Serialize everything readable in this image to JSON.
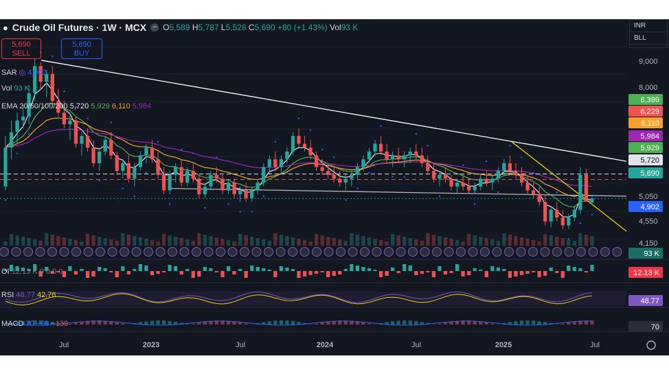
{
  "header": {
    "title": "Crude Oil Futures · 1W · MCX",
    "ohlc_o_label": "O",
    "ohlc_o": "5,589",
    "ohlc_h_label": "H",
    "ohlc_h": "5,787",
    "ohlc_l_label": "L",
    "ohlc_l": "5,528",
    "ohlc_c_label": "C",
    "ohlc_c": "5,690",
    "change": "+80 (+1.43%)",
    "vol_label": "Vol",
    "vol": "93 K"
  },
  "trade": {
    "sell_price": "5,690",
    "sell_label": "SELL",
    "buy_price": "5,690",
    "buy_label": "BUY"
  },
  "indicators": {
    "sar": {
      "label": "SAR",
      "value": "4,902"
    },
    "vol": {
      "label": "Vol",
      "value": "93 K"
    },
    "ema": {
      "label": "EMA 20/50/100/200",
      "v20": "5,720",
      "v50": "5,929",
      "v100": "6,110",
      "v200": "5,984"
    },
    "oi": {
      "label": "OI",
      "value": "12.13 K",
      "extra": "0 0 0 0"
    },
    "rsi": {
      "label": "RSI",
      "value": "48.77",
      "ma": "42.76"
    },
    "macd": {
      "label": "MACD",
      "value": "70",
      "signal": "−69",
      "hist": "−139"
    }
  },
  "currency": {
    "cur": "INR",
    "unit": "BLL"
  },
  "colors": {
    "bg": "#131722",
    "up": "#26a69a",
    "down": "#ef5350",
    "ema20": "#e0e3eb",
    "ema50": "#4caf50",
    "ema100": "#f7a12b",
    "ema200": "#9c27b0",
    "sar": "#2962ff",
    "trend_white": "#ffffff",
    "trend_yellow": "#f0d000"
  },
  "chart_data": {
    "type": "candlestick",
    "symbol": "Crude Oil Futures",
    "interval": "1W",
    "exchange": "MCX",
    "x_tick_labels": [
      "Jul",
      "2023",
      "Jul",
      "2024",
      "Jul",
      "2025",
      "Jul"
    ],
    "y_tick_labels": [
      9000,
      8000,
      5050,
      4550,
      4150
    ],
    "price_axis_labels": [
      {
        "value": "6,399",
        "color": "#4caf50"
      },
      {
        "value": "6,229",
        "color": "#ef5350"
      },
      {
        "value": "6,110",
        "color": "#f7a12b"
      },
      {
        "value": "5,984",
        "color": "#9c27b0"
      },
      {
        "value": "5,929",
        "color": "#4caf50"
      },
      {
        "value": "5,720",
        "color": "#e0e3eb"
      },
      {
        "value": "5,690",
        "color": "#26a69a"
      },
      {
        "value": "4,902",
        "color": "#2962ff"
      }
    ],
    "volume_label": "93 K",
    "oi_label": "12.13 K",
    "rsi_labels": [
      "48.77"
    ],
    "macd_label": "70",
    "candles": [
      {
        "o": 6000,
        "h": 7300,
        "l": 5900,
        "c": 7000
      },
      {
        "o": 7000,
        "h": 7700,
        "l": 6700,
        "c": 7400
      },
      {
        "o": 7400,
        "h": 7900,
        "l": 7100,
        "c": 7700
      },
      {
        "o": 7700,
        "h": 8100,
        "l": 7500,
        "c": 7800
      },
      {
        "o": 7800,
        "h": 8600,
        "l": 7600,
        "c": 8400
      },
      {
        "o": 8400,
        "h": 9300,
        "l": 8200,
        "c": 9100
      },
      {
        "o": 9100,
        "h": 9200,
        "l": 8500,
        "c": 8700
      },
      {
        "o": 8700,
        "h": 9000,
        "l": 8300,
        "c": 8900
      },
      {
        "o": 8900,
        "h": 9100,
        "l": 8100,
        "c": 8200
      },
      {
        "o": 8200,
        "h": 8500,
        "l": 7800,
        "c": 7900
      },
      {
        "o": 7900,
        "h": 8200,
        "l": 7500,
        "c": 7600
      },
      {
        "o": 7600,
        "h": 7900,
        "l": 7200,
        "c": 7700
      },
      {
        "o": 7700,
        "h": 7800,
        "l": 7000,
        "c": 7100
      },
      {
        "o": 7100,
        "h": 7400,
        "l": 6800,
        "c": 7300
      },
      {
        "o": 7300,
        "h": 7500,
        "l": 6900,
        "c": 7000
      },
      {
        "o": 7000,
        "h": 7200,
        "l": 6500,
        "c": 6600
      },
      {
        "o": 6600,
        "h": 7000,
        "l": 6400,
        "c": 6900
      },
      {
        "o": 6900,
        "h": 7300,
        "l": 6800,
        "c": 7200
      },
      {
        "o": 7200,
        "h": 7400,
        "l": 6700,
        "c": 6800
      },
      {
        "o": 6800,
        "h": 6900,
        "l": 6300,
        "c": 6400
      },
      {
        "o": 6400,
        "h": 6700,
        "l": 6200,
        "c": 6600
      },
      {
        "o": 6600,
        "h": 6800,
        "l": 6100,
        "c": 6200
      },
      {
        "o": 6200,
        "h": 6600,
        "l": 6000,
        "c": 6500
      },
      {
        "o": 6500,
        "h": 6900,
        "l": 6400,
        "c": 6800
      },
      {
        "o": 6800,
        "h": 7100,
        "l": 6600,
        "c": 7000
      },
      {
        "o": 7000,
        "h": 7200,
        "l": 6600,
        "c": 6700
      },
      {
        "o": 6700,
        "h": 6900,
        "l": 6200,
        "c": 6300
      },
      {
        "o": 6300,
        "h": 6500,
        "l": 5800,
        "c": 5900
      },
      {
        "o": 5900,
        "h": 6400,
        "l": 5800,
        "c": 6300
      },
      {
        "o": 6300,
        "h": 6600,
        "l": 6100,
        "c": 6500
      },
      {
        "o": 6500,
        "h": 6700,
        "l": 6000,
        "c": 6100
      },
      {
        "o": 6100,
        "h": 6500,
        "l": 6000,
        "c": 6400
      },
      {
        "o": 6400,
        "h": 6600,
        "l": 6100,
        "c": 6200
      },
      {
        "o": 6200,
        "h": 6300,
        "l": 5700,
        "c": 5800
      },
      {
        "o": 5800,
        "h": 6100,
        "l": 5700,
        "c": 6000
      },
      {
        "o": 6000,
        "h": 6400,
        "l": 5900,
        "c": 6300
      },
      {
        "o": 6300,
        "h": 6500,
        "l": 6100,
        "c": 6200
      },
      {
        "o": 6200,
        "h": 6300,
        "l": 5800,
        "c": 5900
      },
      {
        "o": 5900,
        "h": 6200,
        "l": 5800,
        "c": 6100
      },
      {
        "o": 6100,
        "h": 6200,
        "l": 5700,
        "c": 5800
      },
      {
        "o": 5800,
        "h": 6000,
        "l": 5600,
        "c": 5900
      },
      {
        "o": 5900,
        "h": 6100,
        "l": 5600,
        "c": 5700
      },
      {
        "o": 5700,
        "h": 6000,
        "l": 5600,
        "c": 5900
      },
      {
        "o": 5900,
        "h": 6200,
        "l": 5800,
        "c": 6100
      },
      {
        "o": 6100,
        "h": 6600,
        "l": 6000,
        "c": 6500
      },
      {
        "o": 6500,
        "h": 6800,
        "l": 6300,
        "c": 6700
      },
      {
        "o": 6700,
        "h": 6900,
        "l": 6400,
        "c": 6500
      },
      {
        "o": 6500,
        "h": 6800,
        "l": 6300,
        "c": 6700
      },
      {
        "o": 6700,
        "h": 7000,
        "l": 6600,
        "c": 6900
      },
      {
        "o": 6900,
        "h": 7400,
        "l": 6800,
        "c": 7300
      },
      {
        "o": 7300,
        "h": 7500,
        "l": 7000,
        "c": 7100
      },
      {
        "o": 7100,
        "h": 7300,
        "l": 6900,
        "c": 7000
      },
      {
        "o": 7000,
        "h": 7200,
        "l": 6700,
        "c": 6800
      },
      {
        "o": 6800,
        "h": 6900,
        "l": 6400,
        "c": 6500
      },
      {
        "o": 6500,
        "h": 6700,
        "l": 6300,
        "c": 6400
      },
      {
        "o": 6400,
        "h": 6600,
        "l": 6200,
        "c": 6300
      },
      {
        "o": 6300,
        "h": 6500,
        "l": 6100,
        "c": 6200
      },
      {
        "o": 6200,
        "h": 6400,
        "l": 6000,
        "c": 6100
      },
      {
        "o": 6100,
        "h": 6300,
        "l": 5900,
        "c": 6200
      },
      {
        "o": 6200,
        "h": 6400,
        "l": 6000,
        "c": 6300
      },
      {
        "o": 6300,
        "h": 6600,
        "l": 6200,
        "c": 6500
      },
      {
        "o": 6500,
        "h": 6800,
        "l": 6400,
        "c": 6700
      },
      {
        "o": 6700,
        "h": 7000,
        "l": 6600,
        "c": 6900
      },
      {
        "o": 6900,
        "h": 7200,
        "l": 6800,
        "c": 7100
      },
      {
        "o": 7100,
        "h": 7300,
        "l": 6800,
        "c": 6900
      },
      {
        "o": 6900,
        "h": 7100,
        "l": 6600,
        "c": 6700
      },
      {
        "o": 6700,
        "h": 6900,
        "l": 6500,
        "c": 6800
      },
      {
        "o": 6800,
        "h": 7000,
        "l": 6600,
        "c": 6700
      },
      {
        "o": 6700,
        "h": 6900,
        "l": 6500,
        "c": 6800
      },
      {
        "o": 6800,
        "h": 7000,
        "l": 6600,
        "c": 6900
      },
      {
        "o": 6900,
        "h": 7100,
        "l": 6700,
        "c": 6800
      },
      {
        "o": 6800,
        "h": 7000,
        "l": 6500,
        "c": 6600
      },
      {
        "o": 6600,
        "h": 6800,
        "l": 6300,
        "c": 6400
      },
      {
        "o": 6400,
        "h": 6600,
        "l": 6100,
        "c": 6200
      },
      {
        "o": 6200,
        "h": 6400,
        "l": 6000,
        "c": 6300
      },
      {
        "o": 6300,
        "h": 6500,
        "l": 6100,
        "c": 6200
      },
      {
        "o": 6200,
        "h": 6300,
        "l": 5900,
        "c": 6000
      },
      {
        "o": 6000,
        "h": 6200,
        "l": 5800,
        "c": 6100
      },
      {
        "o": 6100,
        "h": 6300,
        "l": 5900,
        "c": 6000
      },
      {
        "o": 6000,
        "h": 6200,
        "l": 5800,
        "c": 5900
      },
      {
        "o": 5900,
        "h": 6100,
        "l": 5800,
        "c": 6000
      },
      {
        "o": 6000,
        "h": 6300,
        "l": 5900,
        "c": 6200
      },
      {
        "o": 6200,
        "h": 6400,
        "l": 6000,
        "c": 6100
      },
      {
        "o": 6100,
        "h": 6300,
        "l": 5900,
        "c": 6200
      },
      {
        "o": 6200,
        "h": 6500,
        "l": 6100,
        "c": 6400
      },
      {
        "o": 6400,
        "h": 6700,
        "l": 6300,
        "c": 6600
      },
      {
        "o": 6600,
        "h": 6800,
        "l": 6300,
        "c": 6400
      },
      {
        "o": 6400,
        "h": 6600,
        "l": 6200,
        "c": 6300
      },
      {
        "o": 6300,
        "h": 6500,
        "l": 6000,
        "c": 6100
      },
      {
        "o": 6100,
        "h": 6300,
        "l": 5800,
        "c": 5900
      },
      {
        "o": 5900,
        "h": 6100,
        "l": 5700,
        "c": 5800
      },
      {
        "o": 5800,
        "h": 6000,
        "l": 5500,
        "c": 5600
      },
      {
        "o": 5600,
        "h": 5800,
        "l": 5000,
        "c": 5100
      },
      {
        "o": 5100,
        "h": 5500,
        "l": 4950,
        "c": 5400
      },
      {
        "o": 5400,
        "h": 5600,
        "l": 5100,
        "c": 5200
      },
      {
        "o": 5200,
        "h": 5400,
        "l": 4900,
        "c": 5000
      },
      {
        "o": 5000,
        "h": 5300,
        "l": 4900,
        "c": 5200
      },
      {
        "o": 5200,
        "h": 5500,
        "l": 5100,
        "c": 5400
      },
      {
        "o": 5400,
        "h": 6500,
        "l": 5300,
        "c": 6300
      },
      {
        "o": 6300,
        "h": 6450,
        "l": 5700,
        "c": 5610
      },
      {
        "o": 5589,
        "h": 5787,
        "l": 5528,
        "c": 5690
      }
    ]
  }
}
